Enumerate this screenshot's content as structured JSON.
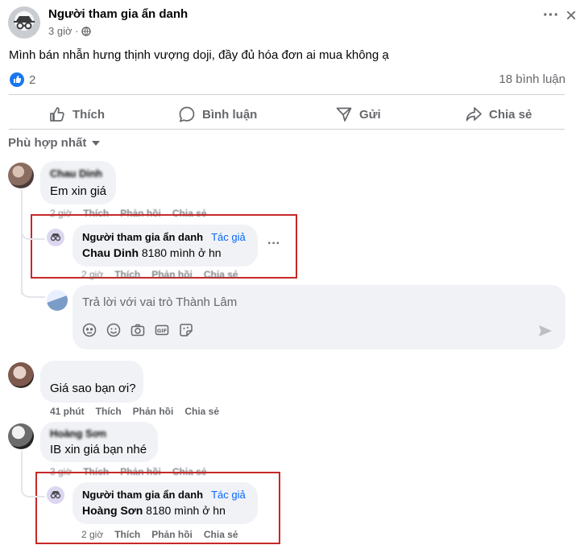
{
  "post": {
    "author": "Người tham gia ẩn danh",
    "time": "3 giờ ·",
    "text": "Mình bán nhẫn hưng thịnh vượng doji, đầy đủ hóa đơn ai mua không ạ",
    "reactions_count": "2",
    "comments_count": "18 bình luận",
    "more_label": "···",
    "close_label": "×"
  },
  "actions": {
    "like": "Thích",
    "comment": "Bình luận",
    "send": "Gửi",
    "share": "Chia sẻ"
  },
  "sort_label": "Phù hợp nhất",
  "comments": [
    {
      "author": "Chau Dinh",
      "text": "Em xin giá",
      "time": "2 giờ",
      "like": "Thích",
      "reply": "Phản hồi",
      "share": "Chia sẻ",
      "reply_comment": {
        "author": "Người tham gia ẩn danh",
        "badge": "Tác giả",
        "mention": "Chau Dinh",
        "text": " 8180 mình ở hn",
        "time": "2 giờ",
        "like": "Thích",
        "reply": "Phản hồi",
        "share": "Chia sẻ",
        "more": "···"
      }
    },
    {
      "author": "",
      "text": "Giá sao bạn ơi?",
      "time": "41 phút",
      "like": "Thích",
      "reply": "Phản hồi",
      "share": "Chia sẻ"
    },
    {
      "author": "Hoàng Sơn",
      "text": "IB xin giá bạn nhé",
      "time": "3 giờ",
      "like": "Thích",
      "reply": "Phản hồi",
      "share": "Chia sẻ",
      "reply_comment": {
        "author": "Người tham gia ẩn danh",
        "badge": "Tác giả",
        "mention": "Hoàng Sơn",
        "text": " 8180 mình ở hn",
        "time": "2 giờ",
        "like": "Thích",
        "reply": "Phản hồi",
        "share": "Chia sẻ"
      }
    }
  ],
  "reply_box": {
    "placeholder": "Trả lời với vai trò Thành Lâm",
    "tools": [
      "avatar-sticker-icon",
      "emoji-icon",
      "camera-icon",
      "gif-icon",
      "sticker-icon"
    ]
  },
  "colors": {
    "link": "#0866ff",
    "highlight": "#c62828",
    "muted": "#65676b"
  }
}
